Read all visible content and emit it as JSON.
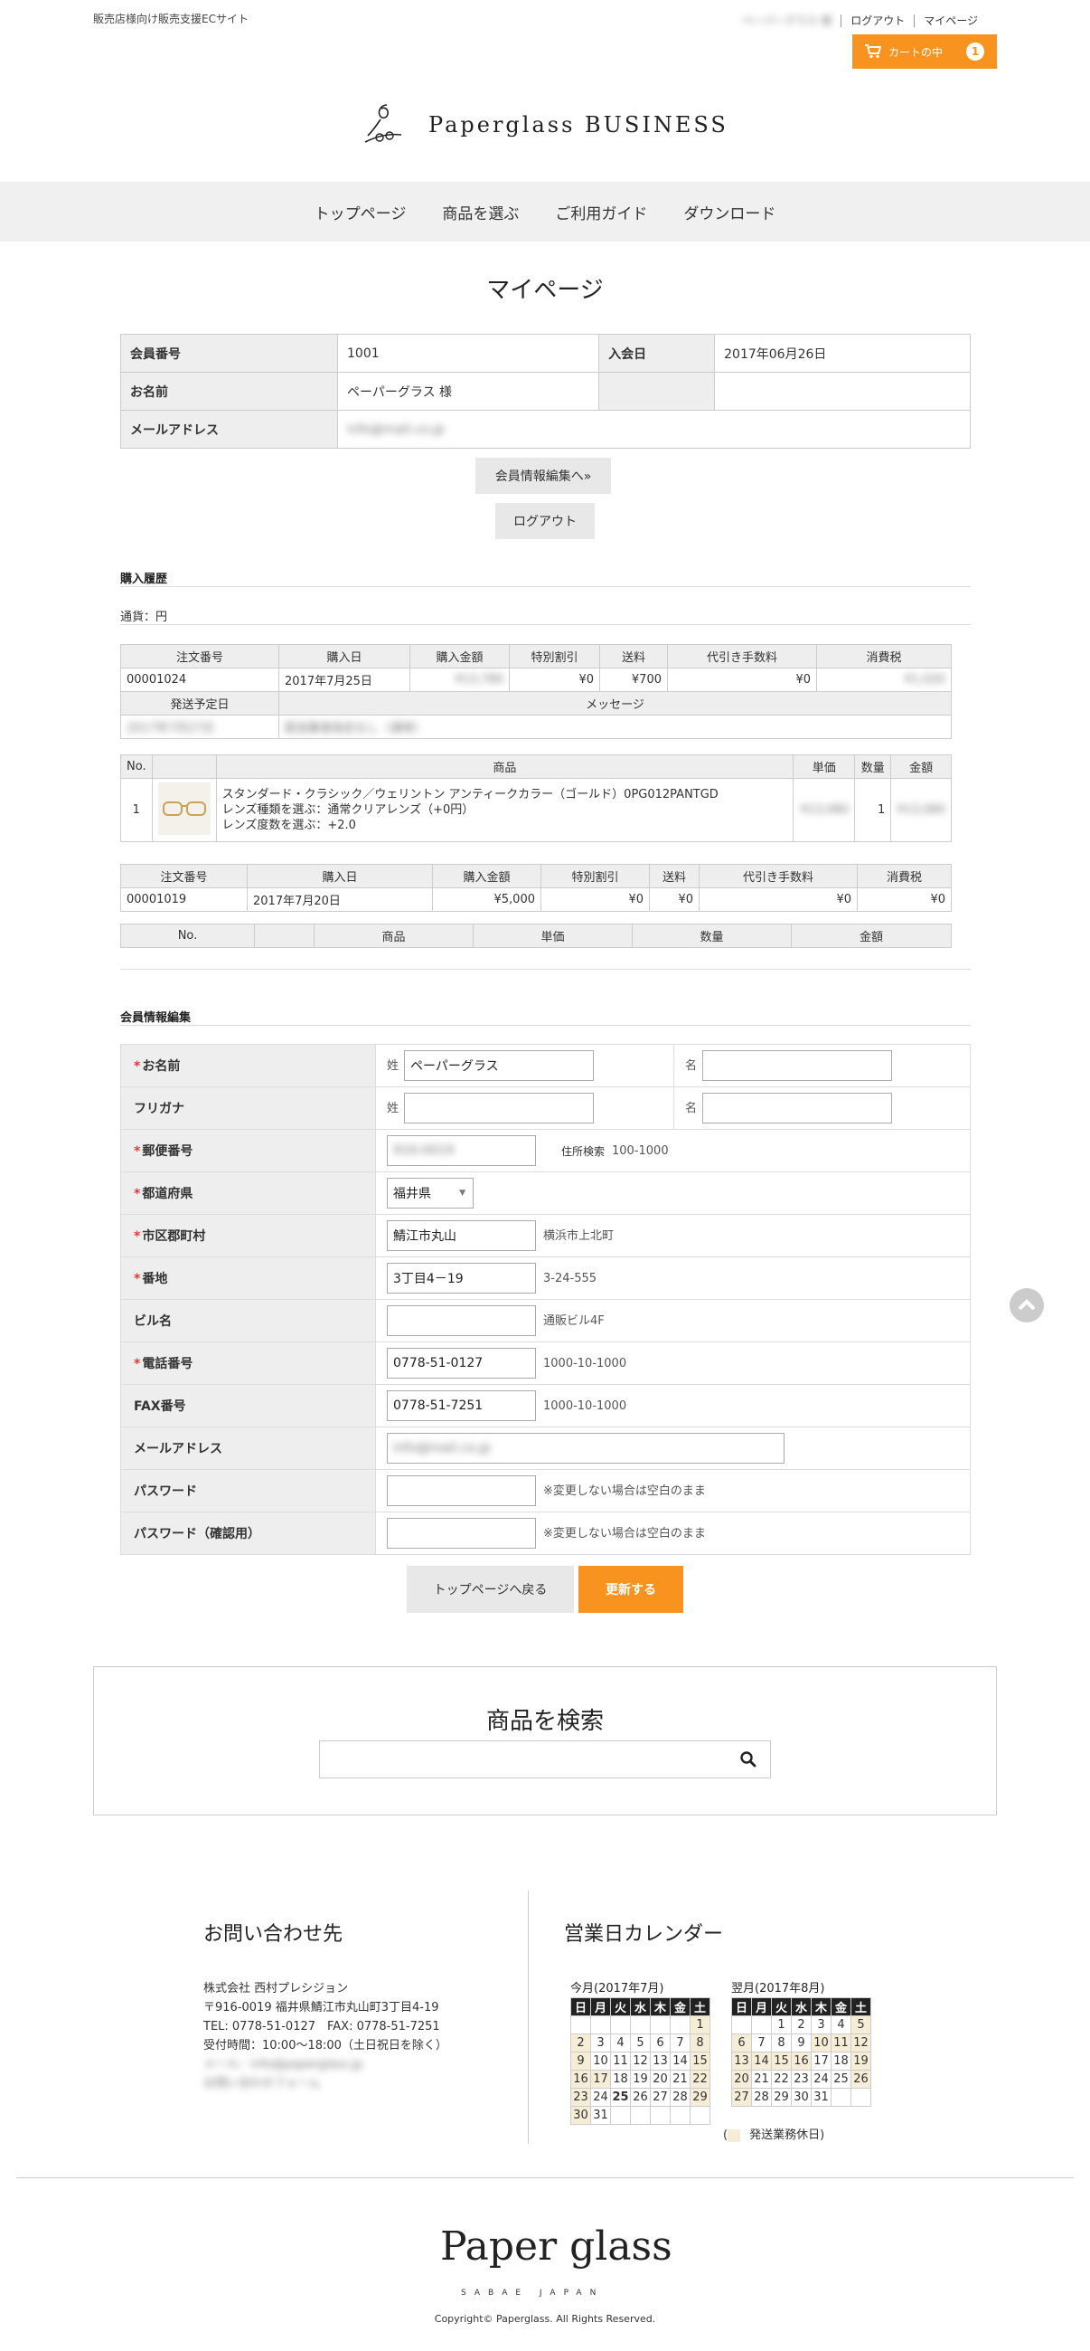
{
  "header": {
    "tagline": "販売店様向け販売支援ECサイト",
    "user_name": "ペーパーグラス 様",
    "logout": "ログアウト",
    "mypage": "マイページ",
    "cart_label": "カートの中",
    "cart_count": "1",
    "logo_text": "Paperglass BUSINESS"
  },
  "nav": [
    "トップページ",
    "商品を選ぶ",
    "ご利用ガイド",
    "ダウンロード"
  ],
  "page_title": "マイページ",
  "member": {
    "id_label": "会員番号",
    "id": "1001",
    "join_label": "入会日",
    "join": "2017年06月26日",
    "name_label": "お名前",
    "name": "ペーパーグラス 様",
    "mail_label": "メールアドレス",
    "mail": "info@mail.co.jp",
    "edit_btn": "会員情報編集へ»",
    "logout_btn": "ログアウト"
  },
  "history": {
    "title": "購入履歴",
    "currency": "通貨：円",
    "order_headers": [
      "注文番号",
      "購入日",
      "購入金額",
      "特別割引",
      "送料",
      "代引き手数料",
      "消費税"
    ],
    "order1": {
      "values": [
        "00001024",
        "2017年7月25日",
        "¥13,780",
        "¥0",
        "¥700",
        "¥0",
        "¥1,020"
      ],
      "ship_label": "発送予定日",
      "ship": "2017年7月27日",
      "msg_label": "メッセージ",
      "msg": "配送業者指定なし（通常）"
    },
    "item_headers": [
      "No.",
      "",
      "商品",
      "単価",
      "数量",
      "金額"
    ],
    "item1": {
      "no": "1",
      "name": "スタンダード・クラシック／ウェリントン アンティークカラー（ゴールド）0PG012PANTGD",
      "lens_type": "レンズ種類を選ぶ：通常クリアレンズ（+0円）",
      "lens_power": "レンズ度数を選ぶ：+2.0",
      "price": "¥13,080",
      "qty": "1",
      "amount": "¥13,080"
    },
    "order2": {
      "values": [
        "00001019",
        "2017年7月20日",
        "¥5,000",
        "¥0",
        "¥0",
        "¥0",
        "¥0"
      ]
    },
    "item2_headers": [
      "No.",
      "",
      "商品",
      "単価",
      "数量",
      "金額"
    ]
  },
  "edit": {
    "title": "会員情報編集",
    "sei": "姓",
    "mei": "名",
    "rows": {
      "name": {
        "label": "お名前",
        "sei": "ペーパーグラス",
        "mei": ""
      },
      "kana": {
        "label": "フリガナ",
        "sei": "",
        "mei": ""
      },
      "zip": {
        "label": "郵便番号",
        "value": "916-0019",
        "btn": "住所検索",
        "example": "100-1000"
      },
      "pref": {
        "label": "都道府県",
        "value": "福井県"
      },
      "city": {
        "label": "市区郡町村",
        "value": "鯖江市丸山",
        "example": "横浜市上北町"
      },
      "addr": {
        "label": "番地",
        "value": "3丁目4－19",
        "example": "3-24-555"
      },
      "bldg": {
        "label": "ビル名",
        "value": "",
        "example": "通販ビル4F"
      },
      "tel": {
        "label": "電話番号",
        "value": "0778-51-0127",
        "example": "1000-10-1000"
      },
      "fax": {
        "label": "FAX番号",
        "value": "0778-51-7251",
        "example": "1000-10-1000"
      },
      "mail": {
        "label": "メールアドレス",
        "value": "info@mail.co.jp"
      },
      "pw": {
        "label": "パスワード",
        "note": "※変更しない場合は空白のまま"
      },
      "pw2": {
        "label": "パスワード（確認用）",
        "note": "※変更しない場合は空白のまま"
      }
    },
    "back_btn": "トップページへ戻る",
    "update_btn": "更新する"
  },
  "search": {
    "title": "商品を検索",
    "placeholder": ""
  },
  "footer": {
    "contact_title": "お問い合わせ先",
    "contact_lines": [
      "株式会社 西村プレシジョン",
      "〒916-0019 福井県鯖江市丸山町3丁目4-19",
      "TEL: 0778-51-0127　FAX: 0778-51-7251",
      "受付時間：10:00～18:00（土日祝日を除く）",
      "メール：info@paperglass.jp",
      "お問い合わせフォーム"
    ],
    "calendar_title": "営業日カレンダー",
    "cal1_caption": "今月(2017年7月)",
    "cal2_caption": "翌月(2017年8月)",
    "weekdays": [
      "日",
      "月",
      "火",
      "水",
      "木",
      "金",
      "土"
    ],
    "legend": "発送業務休日",
    "logo": "Paper glass",
    "logo_sub": "SABAE JAPAN",
    "copyright": "Copyright© Paperglass. All Rights Reserved."
  },
  "colors": {
    "accent": "#f7931e",
    "required": "#e33333",
    "holiday": "#f6edd6"
  }
}
